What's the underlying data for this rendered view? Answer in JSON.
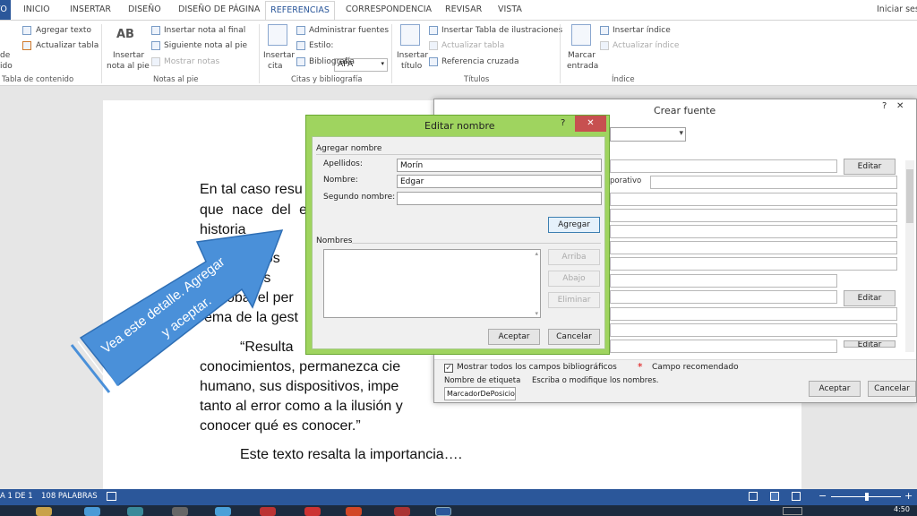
{
  "tabs": {
    "archivo": "VO",
    "inicio": "INICIO",
    "insertar": "INSERTAR",
    "diseno": "DISEÑO",
    "diseno_pagina": "DISEÑO DE PÁGINA",
    "referencias": "REFERENCIAS",
    "correspondencia": "CORRESPONDENCIA",
    "revisar": "REVISAR",
    "vista": "VISTA",
    "signin": "Iniciar sesi"
  },
  "ribbon": {
    "toc": {
      "agregar_texto": "Agregar texto",
      "actualizar_tabla": "Actualizar tabla",
      "tabla_de": "de",
      "contenido_left": "ido",
      "group": "Tabla de contenido"
    },
    "notas": {
      "insertar_nota_pie_1": "Insertar",
      "insertar_nota_pie_2": "nota al pie",
      "insertar_nota_final": "Insertar nota al final",
      "siguiente_nota": "Siguiente nota al pie",
      "mostrar_notas": "Mostrar notas",
      "group": "Notas al pie",
      "ab_icon": "AB"
    },
    "citas": {
      "insertar_cita_1": "Insertar",
      "insertar_cita_2": "cita",
      "administrar_fuentes": "Administrar fuentes",
      "estilo_label": "Estilo:",
      "estilo_value": "APA",
      "bibliografia": "Bibliografía",
      "group": "Citas y bibliografía"
    },
    "titulos": {
      "insertar_titulo_1": "Insertar",
      "insertar_titulo_2": "título",
      "insertar_tabla_ilustraciones": "Insertar Tabla de ilustraciones",
      "actualizar_tabla": "Actualizar tabla",
      "referencia_cruzada": "Referencia cruzada",
      "group": "Títulos"
    },
    "indice": {
      "marcar_entrada_1": "Marcar",
      "marcar_entrada_2": "entrada",
      "insertar_indice": "Insertar índice",
      "actualizar_indice": "Actualizar índice",
      "group": "Índice"
    }
  },
  "document": {
    "l1": "En tal caso resu",
    "l2": "que nace del e",
    "l3": "historia",
    "l4": "nos",
    "l5": "bles",
    "l6": "obal el per",
    "l7": "ema de la gest",
    "l8": "“Resulta",
    "l9": "conocimientos, permanezca cie",
    "l10": "humano, sus dispositivos, impe",
    "l11": "tanto al error como a la ilusión y",
    "l12": "conocer qué es conocer.”",
    "l13": "Este texto resalta la importancia…."
  },
  "callout": {
    "line1": "Vea este detalle. Agregar",
    "line2": "y aceptar.",
    "color": "#4a90d9"
  },
  "crear_fuente": {
    "title": "Crear fuente",
    "help": "?",
    "close": "✕",
    "editar1": "Editar",
    "corporativo": "porativo",
    "editar2": "Editar",
    "editar3": "Editar",
    "mostrar_todos": "Mostrar todos los campos bibliográficos",
    "asterisk": "*",
    "campo_recomendado": "Campo recomendado",
    "nombre_etiqueta": "Nombre de etiqueta",
    "escriba": "Escriba o modifique los nombres.",
    "etiqueta_value": "MarcadorDePosicio",
    "aceptar": "Aceptar",
    "cancelar": "Cancelar"
  },
  "editar_nombre": {
    "title": "Editar nombre",
    "help": "?",
    "close": "✕",
    "agregar_nombre": "Agregar nombre",
    "apellidos_label": "Apellidos:",
    "apellidos_value": "Morín",
    "nombre_label": "Nombre:",
    "nombre_value": "Edgar",
    "segundo_label": "Segundo nombre:",
    "segundo_value": "",
    "agregar": "Agregar",
    "nombres": "Nombres",
    "arriba": "Arriba",
    "abajo": "Abajo",
    "eliminar": "Eliminar",
    "aceptar": "Aceptar",
    "cancelar": "Cancelar"
  },
  "status": {
    "page": "A 1 DE 1",
    "words": "108 PALABRAS",
    "time": "4:50"
  },
  "colors": {
    "accent": "#2b579a",
    "dialog_green": "#9fd45f",
    "close_red": "#c75050"
  }
}
